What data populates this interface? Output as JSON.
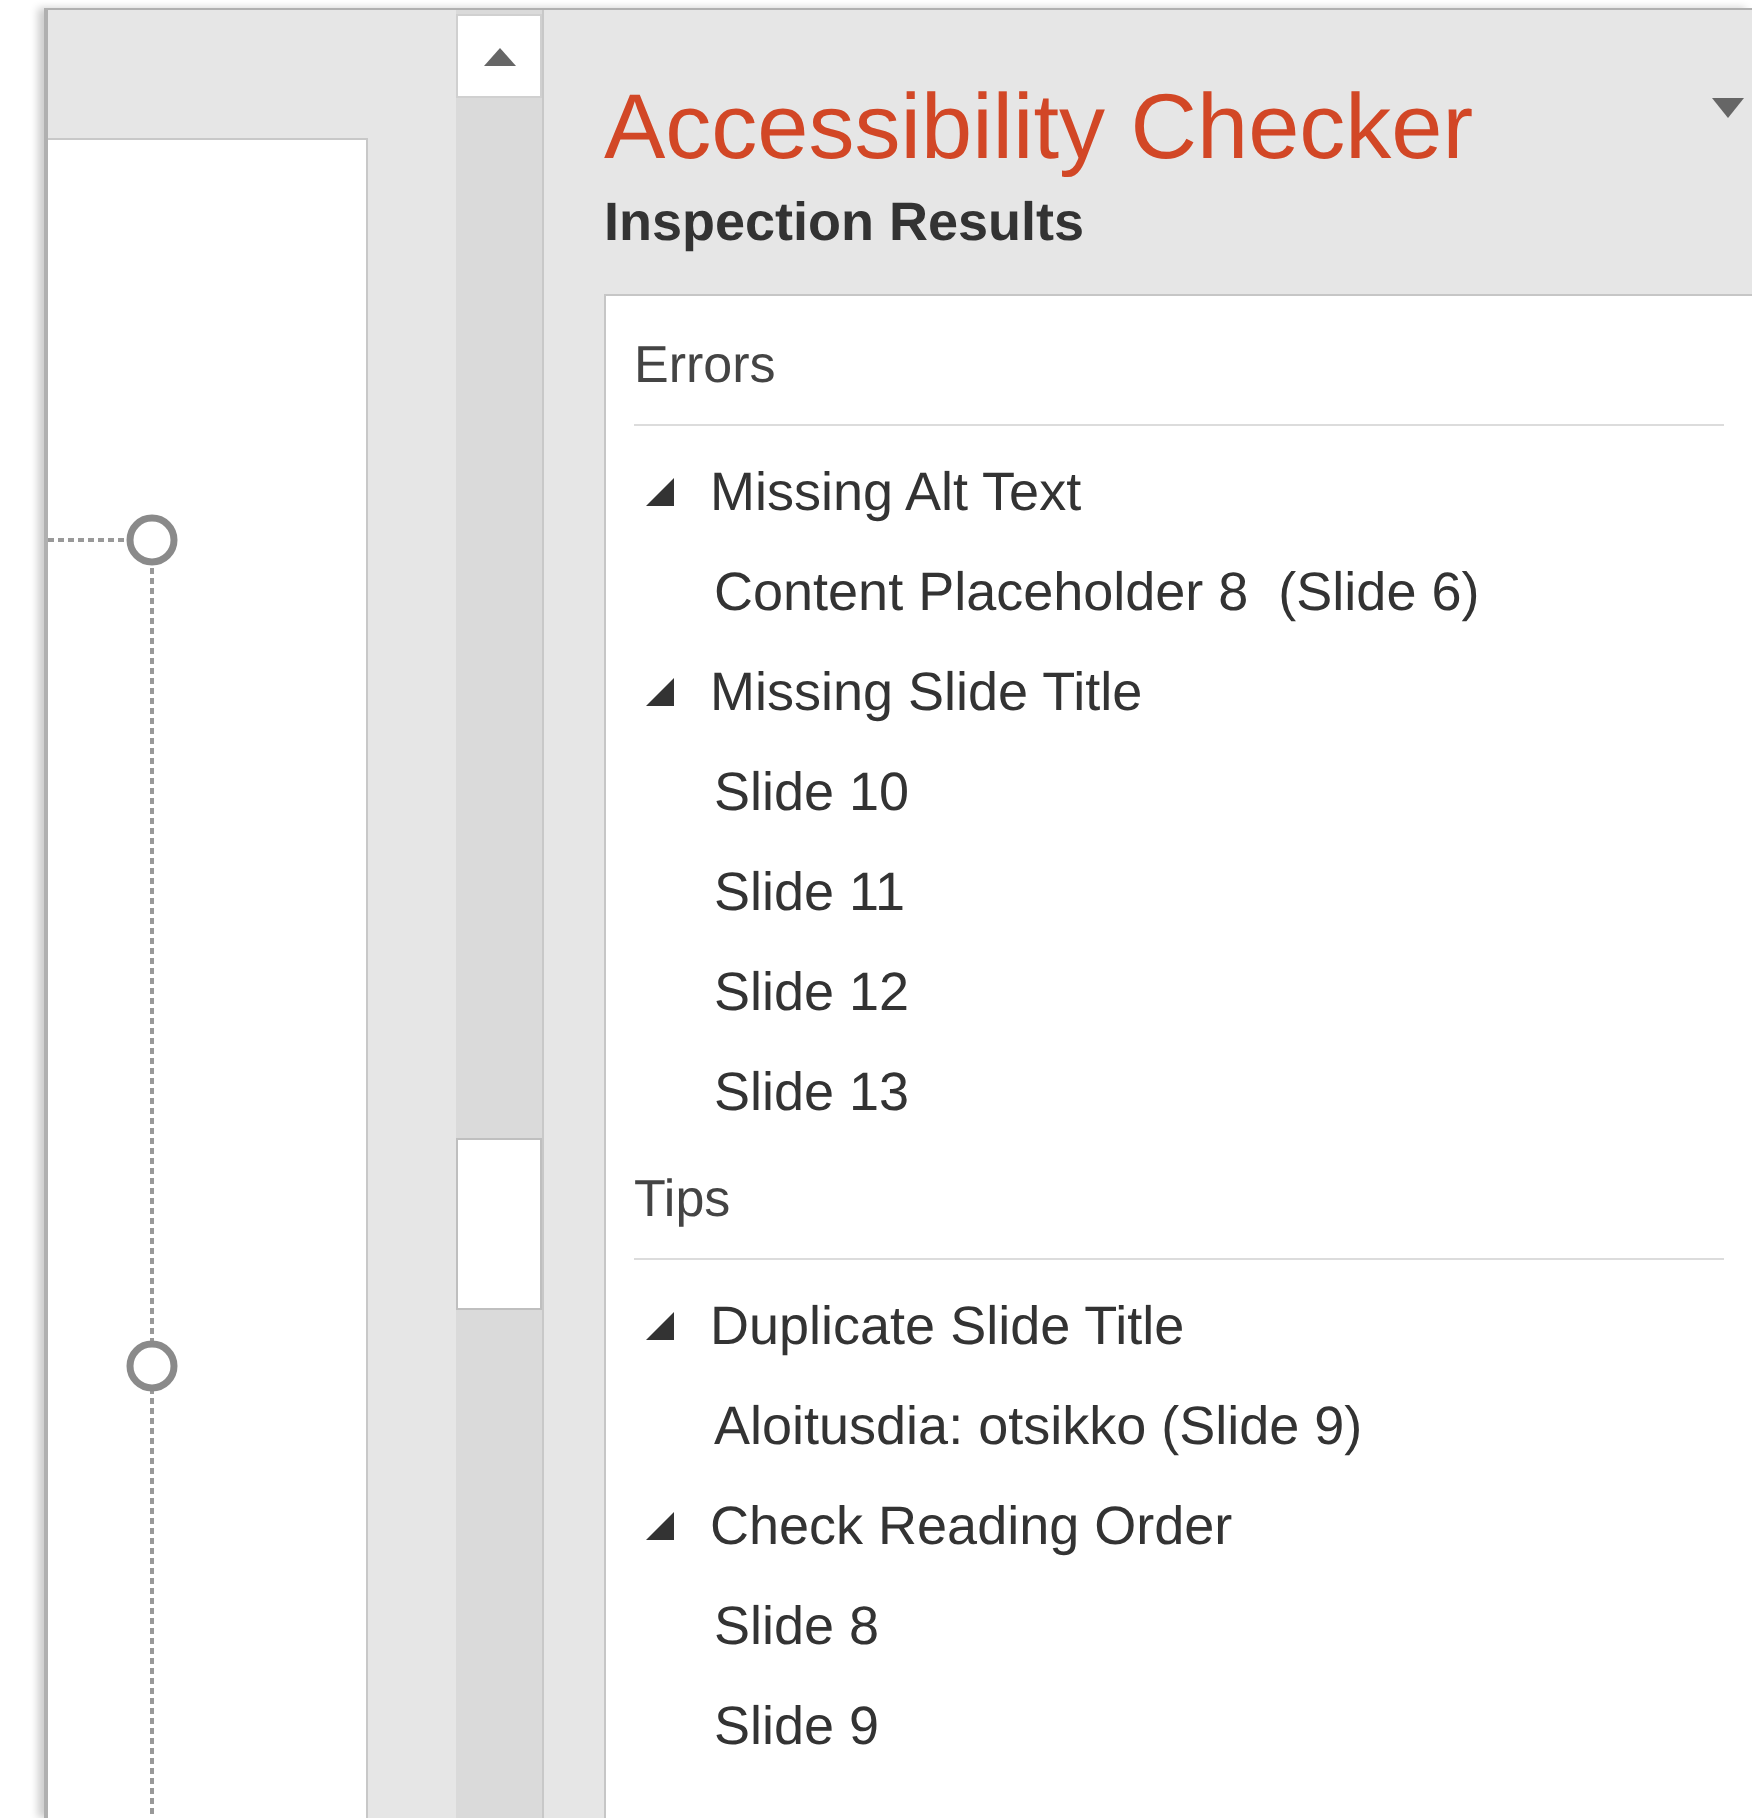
{
  "pane": {
    "title": "Accessibility Checker",
    "subtitle": "Inspection Results"
  },
  "sections": [
    {
      "title": "Errors",
      "groups": [
        {
          "title": "Missing Alt Text",
          "expanded": true,
          "items": [
            "Content Placeholder 8  (Slide 6)"
          ]
        },
        {
          "title": "Missing Slide Title",
          "expanded": true,
          "items": [
            "Slide 10",
            "Slide 11",
            "Slide 12",
            "Slide 13"
          ]
        }
      ]
    },
    {
      "title": "Tips",
      "groups": [
        {
          "title": "Duplicate Slide Title",
          "expanded": true,
          "items": [
            "Aloitusdia: otsikko (Slide 9)"
          ]
        },
        {
          "title": "Check Reading Order",
          "expanded": true,
          "items": [
            "Slide 8",
            "Slide 9"
          ]
        }
      ]
    }
  ]
}
